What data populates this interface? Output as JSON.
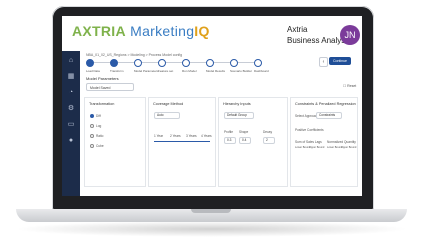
{
  "app": {
    "logo_brand": "AXTRIA",
    "logo_product": "Marketing",
    "logo_suffix": "IQ",
    "company": "Axtria",
    "role": "Business Analyst",
    "avatar_initials": "JN"
  },
  "breadcrumb": "NBA_01_02_US_Regions > Modeling > Process Model config",
  "steps": [
    {
      "label": "Load Data",
      "done": true
    },
    {
      "label": "Transform",
      "done": true
    },
    {
      "label": "Model Parameters",
      "done": false
    },
    {
      "label": "Feature set",
      "done": false
    },
    {
      "label": "Run Model",
      "done": false
    },
    {
      "label": "Model Results",
      "done": false
    },
    {
      "label": "Scenario Builder",
      "done": false
    },
    {
      "label": "Dashboard",
      "done": false
    }
  ],
  "toolbar": {
    "continue_label": "Continue",
    "back_label": "‹"
  },
  "section_title": "Model Parameters",
  "model_select": "Model Saved",
  "reset_label": "Reset",
  "panels": {
    "transformation": {
      "title": "Transformation",
      "options": [
        "Diff",
        "Log",
        "Ratio",
        "Cube"
      ]
    },
    "coverage": {
      "title": "Coverage Method",
      "select": "Auto",
      "ticks": [
        "1 Year",
        "2 Years",
        "3 Years",
        "4 Years"
      ]
    },
    "hierarchy": {
      "title": "Hierarchy Inputs",
      "select": "Default Group",
      "col_labels": [
        "Profile",
        "Shape",
        "Decay"
      ],
      "values": [
        "0.3",
        "0.4",
        "2"
      ]
    },
    "constraints": {
      "title": "Constraints & Penalized Regression",
      "select_label": "Select Approach",
      "select_value": "Constraints",
      "coef_label": "Positive Coefficients",
      "sum_label": "Sum of Sales Lags",
      "norm_label": "Normalized Quantity",
      "bounds": [
        "Lower Bound",
        "Upper Bound",
        "Lower Bound",
        "Upper Bound"
      ]
    }
  }
}
